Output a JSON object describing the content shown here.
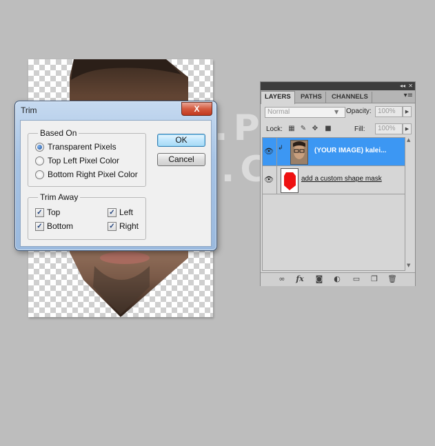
{
  "watermark": "WWW.PSD-DUDE.COM",
  "dialog": {
    "title": "Trim",
    "close_label": "X",
    "based_on": {
      "legend": "Based On",
      "options": [
        "Transparent Pixels",
        "Top Left Pixel Color",
        "Bottom Right Pixel Color"
      ],
      "selected_index": 0
    },
    "trim_away": {
      "legend": "Trim Away",
      "top": "Top",
      "bottom": "Bottom",
      "left": "Left",
      "right": "Right",
      "checkmark": "✓"
    },
    "ok_label": "OK",
    "cancel_label": "Cancel"
  },
  "layers_panel": {
    "tabs": [
      "LAYERS",
      "PATHS",
      "CHANNELS"
    ],
    "active_tab": "LAYERS",
    "blend_mode": "Normal",
    "opacity_label": "Opacity:",
    "opacity_value": "100%",
    "lock_label": "Lock:",
    "fill_label": "Fill:",
    "fill_value": "100%",
    "layers": [
      {
        "name": "(YOUR IMAGE) kalei...",
        "selected": true
      },
      {
        "name": "add a custom shape mask",
        "selected": false
      }
    ],
    "colors": {
      "selection": "#3c97f3",
      "mask_shape": "#ee1111"
    }
  }
}
